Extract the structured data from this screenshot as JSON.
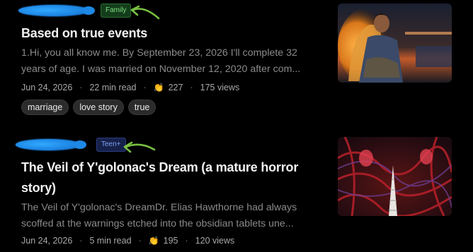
{
  "stories": [
    {
      "badge": "Family",
      "title": "Based on true events",
      "excerpt": [
        "1.Hi, you all know me. By September 23, 2026 I'll complete 32",
        "years of age. I was married on November 12, 2020 after com..."
      ],
      "date": "Jun 24, 2026",
      "read_time": "22 min read",
      "claps": "227",
      "views": "175 views",
      "tags": [
        "marriage",
        "love story",
        "true"
      ],
      "thumb_icon": "man-embracing-golden-figure-image"
    },
    {
      "badge": "Teen+",
      "title_lines": [
        "The Veil of Y'golonac's Dream (a mature horror",
        "story)"
      ],
      "excerpt": [
        "The Veil of Y'golonac's DreamDr. Elias Hawthorne had always",
        "scoffed at the warnings etched into the obsidian tablets une..."
      ],
      "date": "Jun 24, 2026",
      "read_time": "5 min read",
      "claps": "195",
      "views": "120 views",
      "thumb_icon": "red-tentacle-horror-image"
    }
  ],
  "sep": "·",
  "clap_icon": "👏",
  "colors": {
    "family_badge": "#7bdc7f",
    "teen_badge": "#7f9ff5",
    "arrow": "#7ac142",
    "redaction": "#1e88e5"
  }
}
